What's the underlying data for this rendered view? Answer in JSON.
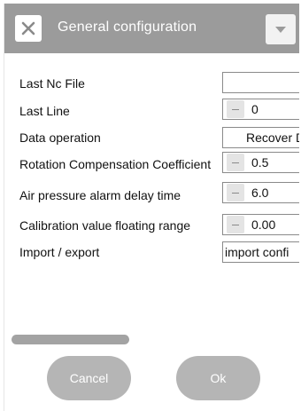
{
  "dialog": {
    "title": "General configuration",
    "close_icon": "close-x-icon",
    "menu_icon": "caret-down-icon"
  },
  "fields": [
    {
      "label": "Last Nc File",
      "value": "",
      "type": "text"
    },
    {
      "label": "Last Line",
      "value": "0",
      "type": "stepper"
    },
    {
      "label": "Data operation",
      "value": "Recover D",
      "type": "select"
    },
    {
      "label": "Rotation Compensation Coefficient",
      "value": "0.5",
      "type": "stepper"
    },
    {
      "label": "Air pressure alarm delay time",
      "value": "6.0",
      "type": "stepper"
    },
    {
      "label": "Calibration value floating range",
      "value": "0.00",
      "type": "stepper"
    },
    {
      "label": "Import / export",
      "value": "import confi",
      "type": "select"
    }
  ],
  "footer": {
    "cancel_label": "Cancel",
    "ok_label": "Ok"
  },
  "colors": {
    "titlebar": "#9b9b9b",
    "button": "#b5b5b5",
    "scrollbar": "#a3a3a3"
  }
}
